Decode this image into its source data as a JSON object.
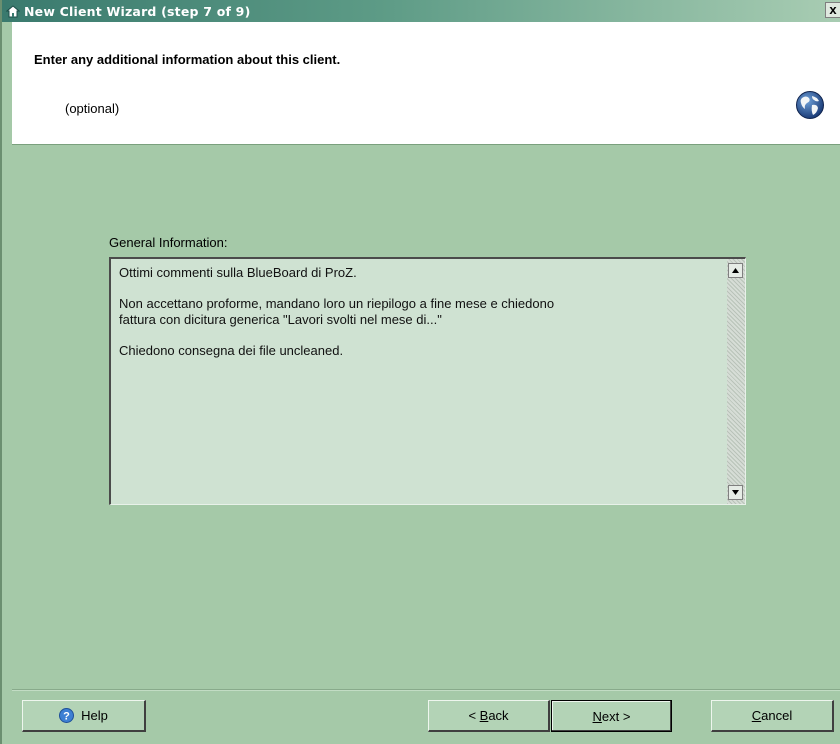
{
  "window": {
    "title": "New Client Wizard  (step 7 of 9)",
    "close_label": "x"
  },
  "header": {
    "title": "Enter any additional information about this client.",
    "subtitle": "(optional)"
  },
  "general_info": {
    "label": "General Information:",
    "value": "Ottimi commenti sulla BlueBoard di ProZ.\n\nNon accettano proforme, mandano loro un riepilogo a fine mese e chiedono\nfattura con dicitura generica \"Lavori svolti nel mese di...\"\n\nChiedono consegna dei file uncleaned."
  },
  "buttons": {
    "help": "Help",
    "back_prefix": "< ",
    "back_mnemonic": "B",
    "back_rest": "ack",
    "next_mnemonic": "N",
    "next_rest": "ext >",
    "cancel_mnemonic": "C",
    "cancel_rest": "ancel"
  },
  "icons": {
    "title": "wizard-home-icon",
    "header": "globe-icon",
    "help": "help-question-icon"
  },
  "colors": {
    "background": "#a5c9a8",
    "textarea": "#cfe2d2",
    "titlebar_start": "#3a7a6e"
  }
}
